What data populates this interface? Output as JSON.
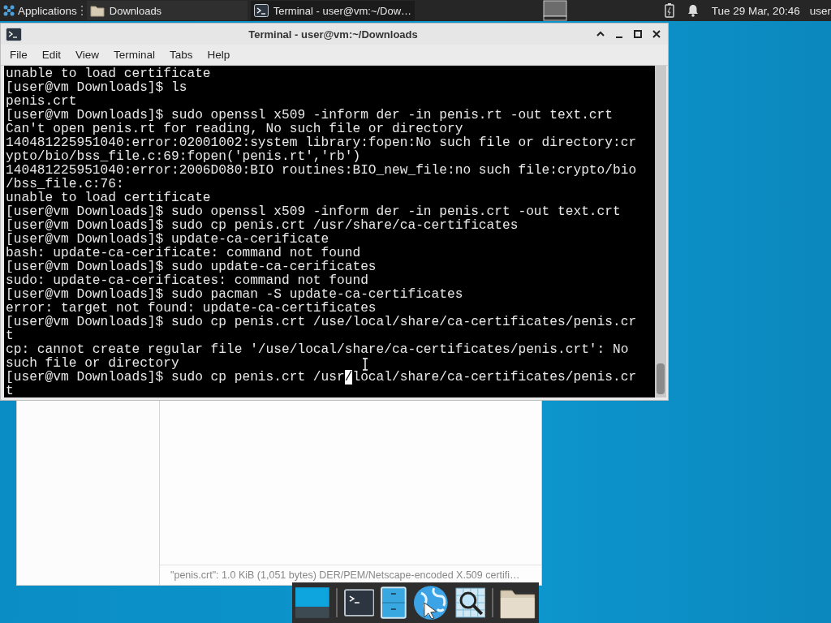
{
  "top_panel": {
    "applications_label": "Applications",
    "tasks": [
      {
        "kind": "folder",
        "label": "Downloads",
        "selected": false
      },
      {
        "kind": "terminal",
        "label": "Terminal - user@vm:~/Dow…",
        "selected": true
      }
    ],
    "clock": "Tue 29 Mar, 20:46",
    "user": "user"
  },
  "terminal_window": {
    "title": "Terminal - user@vm:~/Downloads",
    "menu": [
      "File",
      "Edit",
      "View",
      "Terminal",
      "Tabs",
      "Help"
    ],
    "lines": [
      {
        "text": "unable to load certificate"
      },
      {
        "text": "[user@vm Downloads]$ ls"
      },
      {
        "text": "penis.crt"
      },
      {
        "text": "[user@vm Downloads]$ sudo openssl x509 -inform der -in penis.rt -out text.crt"
      },
      {
        "text": "Can't open penis.rt for reading, No such file or directory"
      },
      {
        "text": "140481225951040:error:02001002:system library:fopen:No such file or directory:cr"
      },
      {
        "text": "ypto/bio/bss_file.c:69:fopen('penis.rt','rb')"
      },
      {
        "text": "140481225951040:error:2006D080:BIO routines:BIO_new_file:no such file:crypto/bio"
      },
      {
        "text": "/bss_file.c:76:"
      },
      {
        "text": "unable to load certificate"
      },
      {
        "text": "[user@vm Downloads]$ sudo openssl x509 -inform der -in penis.crt -out text.crt"
      },
      {
        "text": "[user@vm Downloads]$ sudo cp penis.crt /usr/share/ca-certificates"
      },
      {
        "text": "[user@vm Downloads]$ update-ca-cerificate"
      },
      {
        "text": "bash: update-ca-cerificate: command not found"
      },
      {
        "text": "[user@vm Downloads]$ sudo update-ca-cerificates"
      },
      {
        "text": "sudo: update-ca-cerificates: command not found"
      },
      {
        "text": "[user@vm Downloads]$ sudo pacman -S update-ca-certificates"
      },
      {
        "text": "error: target not found: update-ca-certificates"
      },
      {
        "text": "[user@vm Downloads]$ sudo cp penis.crt /use/local/share/ca-certificates/penis.cr"
      },
      {
        "text": "t"
      },
      {
        "text": "cp: cannot create regular file '/use/local/share/ca-certificates/penis.crt': No"
      },
      {
        "text": "such file or directory"
      },
      {
        "kind": "cursor",
        "before": "[user@vm Downloads]$ sudo cp penis.crt /usr",
        "cursor": "/",
        "after": "local/share/ca-certificates/penis.cr"
      },
      {
        "text": "t"
      }
    ]
  },
  "file_manager": {
    "status": "\"penis.crt\": 1.0 KiB (1,051 bytes) DER/PEM/Netscape-encoded X.509 certifi…"
  },
  "dock": {
    "items": [
      {
        "kind": "desktop"
      },
      {
        "kind": "separator"
      },
      {
        "kind": "terminal"
      },
      {
        "kind": "cabinet"
      },
      {
        "kind": "globe"
      },
      {
        "kind": "search"
      },
      {
        "kind": "separator"
      },
      {
        "kind": "folder"
      }
    ]
  }
}
